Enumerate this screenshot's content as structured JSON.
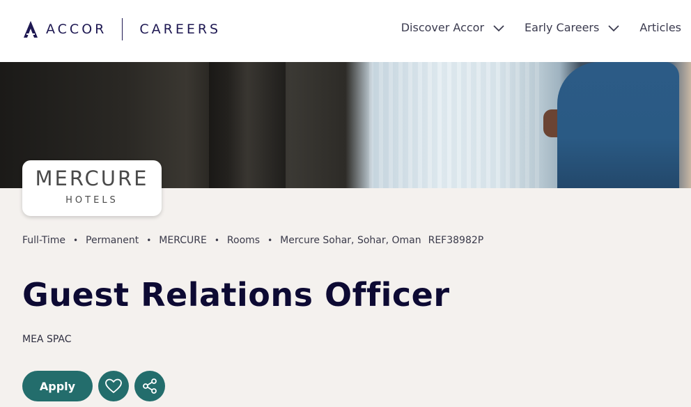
{
  "header": {
    "logo_text": "ACCOR",
    "careers_text": "CAREERS",
    "nav": [
      {
        "label": "Discover Accor",
        "has_dropdown": true
      },
      {
        "label": "Early Careers",
        "has_dropdown": true
      },
      {
        "label": "Articles",
        "has_dropdown": false
      }
    ]
  },
  "brand": {
    "name": "MERCURE",
    "sub": "HOTELS"
  },
  "job": {
    "meta": [
      "Full-Time",
      "Permanent",
      "MERCURE",
      "Rooms",
      "Mercure Sohar, Sohar, Oman"
    ],
    "ref": "REF38982P",
    "title": "Guest Relations Officer",
    "region": "MEA SPAC"
  },
  "actions": {
    "apply_label": "Apply",
    "favorite_icon": "heart-icon",
    "share_icon": "share-icon"
  },
  "colors": {
    "accent": "#236d6c",
    "navy": "#1e1852",
    "background": "#f4f1ee"
  }
}
